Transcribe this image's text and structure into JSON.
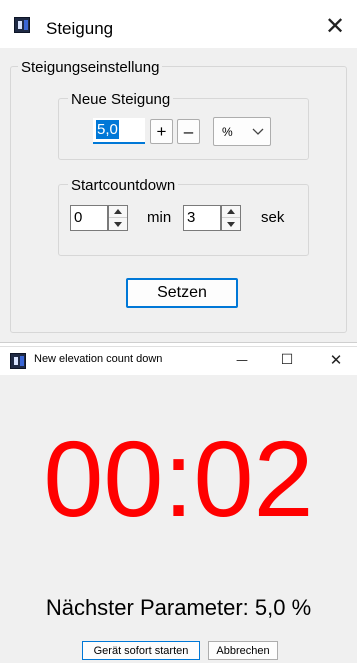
{
  "window1": {
    "title": "Steigung",
    "outer_group_label": "Steigungseinstellung",
    "new_slope": {
      "label": "Neue Steigung",
      "value": "5,0",
      "plus_label": "+",
      "minus_label": "–",
      "unit_selected": "%"
    },
    "countdown": {
      "label": "Startcountdown",
      "minutes_value": "0",
      "minutes_unit": "min",
      "seconds_value": "3",
      "seconds_unit": "sek"
    },
    "set_button": "Setzen",
    "close_glyph": "✕"
  },
  "window2": {
    "title": "New elevation count down",
    "minimize_glyph": "—",
    "maximize_glyph": "☐",
    "close_glyph": "✕",
    "countdown_time": "00:02",
    "next_parameter": "Nächster Parameter: 5,0 %",
    "start_now_button": "Gerät sofort starten",
    "cancel_button": "Abbrechen"
  },
  "colors": {
    "countdown_red": "#ff0000",
    "window_bg": "#f0f0f0",
    "focus_blue": "#0078d7"
  }
}
